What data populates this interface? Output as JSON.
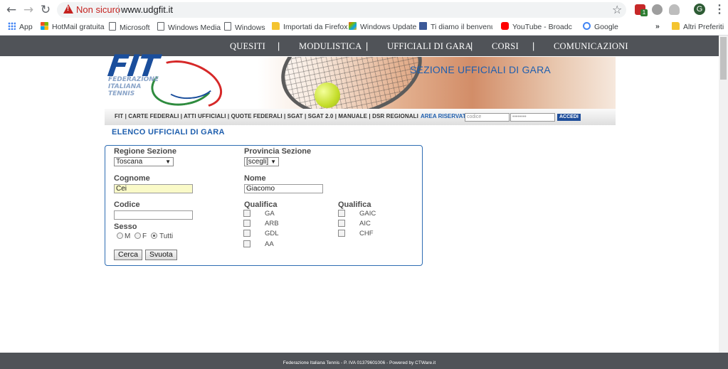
{
  "browser": {
    "security_label": "Non sicuro",
    "url": "www.udgfit.it",
    "profile_initial": "G",
    "extension_badge": "1",
    "bookmarks": [
      {
        "label": "App",
        "icon": "apps-grid-icon"
      },
      {
        "label": "HotMail gratuita",
        "icon": "windows-logo-icon"
      },
      {
        "label": "Microsoft",
        "icon": "page-icon"
      },
      {
        "label": "Windows Media",
        "icon": "page-icon"
      },
      {
        "label": "Windows",
        "icon": "page-icon"
      },
      {
        "label": "Importati da Firefox",
        "icon": "folder-icon"
      },
      {
        "label": "Windows Update",
        "icon": "windows-flag-icon"
      },
      {
        "label": "Ti diamo il benvenuto",
        "icon": "facebook-icon"
      },
      {
        "label": "YouTube - Broadcast",
        "icon": "youtube-icon"
      },
      {
        "label": "Google",
        "icon": "google-icon"
      }
    ],
    "more_bookmarks": "»",
    "other_bookmarks": "Altri Preferiti"
  },
  "nav": {
    "items": [
      "QUESITI",
      "MODULISTICA",
      "UFFICIALI DI GARA",
      "CORSI",
      "COMUNICAZIONI"
    ],
    "separator": "|"
  },
  "header": {
    "logo_text": "FIT",
    "logo_sub": "FEDERAZIONE ITALIANA TENNIS",
    "section_title": "SEZIONE UFFICIALI DI GARA"
  },
  "subnav": {
    "links": "FIT | CARTE FEDERALI | ATTI UFFICIALI | QUOTE FEDERALI | SGAT | SGAT 2.0 | MANUALE | DSR REGIONALI",
    "area_label": "AREA RISERVATA",
    "code_placeholder": "codice",
    "password_value": "••••••••",
    "login_label": "ACCEDI"
  },
  "page_heading": "ELENCO UFFICIALI DI GARA",
  "form": {
    "regione_label": "Regione Sezione",
    "regione_value": "Toscana",
    "provincia_label": "Provincia Sezione",
    "provincia_value": "[scegli]",
    "cognome_label": "Cognome",
    "cognome_value": "Cei",
    "nome_label": "Nome",
    "nome_value": "Giacomo",
    "codice_label": "Codice",
    "codice_value": "",
    "sesso_label": "Sesso",
    "sesso_options": [
      "M",
      "F",
      "Tutti"
    ],
    "sesso_selected": "Tutti",
    "qualifica_label_1": "Qualifica",
    "qualifica_1": [
      "GA",
      "ARB",
      "GDL",
      "AA"
    ],
    "qualifica_label_2": "Qualifica",
    "qualifica_2": [
      "GAIC",
      "AIC",
      "CHF"
    ],
    "search_button": "Cerca",
    "reset_button": "Svuota"
  },
  "footer": "Federazione Italiana Tennis - P. IVA 01379601006 - Powered by CTWare.it",
  "colors": {
    "nav_bg": "#505358",
    "accent_blue": "#1f5fae",
    "form_border": "#2e6db3",
    "highlight_input": "#fafac8",
    "warning_red": "#c5221f"
  }
}
